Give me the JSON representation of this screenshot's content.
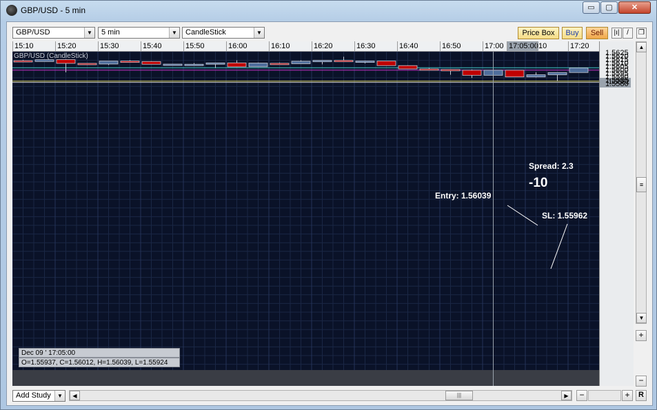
{
  "window": {
    "title": "GBP/USD - 5 min",
    "minimize_glyph": "▭",
    "maximize_glyph": "▢",
    "close_glyph": "✕"
  },
  "toolbar": {
    "symbol": "GBP/USD",
    "interval": "5 min",
    "chart_type": "CandleStick",
    "price_box": "Price Box",
    "buy": "Buy",
    "sell": "Sell"
  },
  "chart": {
    "label": "GBP/USD (CandleStick)",
    "time_ticks": [
      "15:10",
      "15:20",
      "15:30",
      "15:40",
      "15:50",
      "16:00",
      "16:10",
      "16:20",
      "16:30",
      "16:40",
      "16:50",
      "17:00",
      "17:05:00",
      "10",
      "17:20"
    ],
    "price_ticks": [
      "1.5625",
      "1.5620",
      "1.5615",
      "1.5610",
      "1.5605",
      "1.5600",
      "1.5595",
      "1.5590",
      "1.5585",
      "1.5580"
    ],
    "current_price_label": "1.5582",
    "crosshair_time": "17:05:00",
    "info_date": "Dec 09 ' 17:05:00",
    "info_ohlc": "O=1.55937, C=1.56012, H=1.56039, L=1.55924",
    "annotations": {
      "entry": "Entry: 1.56039",
      "sl": "SL: 1.55962",
      "spread": "Spread: 2.3",
      "pips": "-10"
    },
    "horizontal_lines": {
      "cyan": 1.56049,
      "magenta": 1.56012,
      "yellow": 1.55851,
      "white": 1.55832
    },
    "colors": {
      "up": "#4f6e9c",
      "down": "#c00000",
      "background": "#0a1228"
    }
  },
  "chart_data": {
    "type": "candlestick",
    "ylim": [
      1.55775,
      1.56285
    ],
    "candles": [
      {
        "o": 1.56153,
        "h": 1.56163,
        "l": 1.56143,
        "c": 1.5614
      },
      {
        "o": 1.5614,
        "h": 1.56168,
        "l": 1.5614,
        "c": 1.56167
      },
      {
        "o": 1.56168,
        "h": 1.56175,
        "l": 1.5598,
        "c": 1.56113
      },
      {
        "o": 1.56113,
        "h": 1.56118,
        "l": 1.5609,
        "c": 1.56103
      },
      {
        "o": 1.56103,
        "h": 1.56147,
        "l": 1.56088,
        "c": 1.56146
      },
      {
        "o": 1.56147,
        "h": 1.5616,
        "l": 1.5614,
        "c": 1.5614
      },
      {
        "o": 1.5614,
        "h": 1.56146,
        "l": 1.56098,
        "c": 1.561
      },
      {
        "o": 1.561,
        "h": 1.56104,
        "l": 1.56097,
        "c": 1.56102
      },
      {
        "o": 1.561,
        "h": 1.56116,
        "l": 1.56082,
        "c": 1.561
      },
      {
        "o": 1.56101,
        "h": 1.56116,
        "l": 1.56045,
        "c": 1.5612
      },
      {
        "o": 1.5612,
        "h": 1.56158,
        "l": 1.5606,
        "c": 1.56062
      },
      {
        "o": 1.56063,
        "h": 1.56124,
        "l": 1.56063,
        "c": 1.56117
      },
      {
        "o": 1.56114,
        "h": 1.56124,
        "l": 1.56097,
        "c": 1.56106
      },
      {
        "o": 1.56108,
        "h": 1.56158,
        "l": 1.56108,
        "c": 1.56144
      },
      {
        "o": 1.56144,
        "h": 1.56158,
        "l": 1.56098,
        "c": 1.56157
      },
      {
        "o": 1.56157,
        "h": 1.5621,
        "l": 1.56145,
        "c": 1.56147
      },
      {
        "o": 1.56147,
        "h": 1.56153,
        "l": 1.56112,
        "c": 1.56147
      },
      {
        "o": 1.56147,
        "h": 1.56147,
        "l": 1.56079,
        "c": 1.5608
      },
      {
        "o": 1.5608,
        "h": 1.56085,
        "l": 1.5603,
        "c": 1.56031
      },
      {
        "o": 1.56031,
        "h": 1.56043,
        "l": 1.56019,
        "c": 1.56023
      },
      {
        "o": 1.56023,
        "h": 1.56027,
        "l": 1.55945,
        "c": 1.56014
      },
      {
        "o": 1.56012,
        "h": 1.56022,
        "l": 1.55899,
        "c": 1.55937
      },
      {
        "o": 1.55937,
        "h": 1.56039,
        "l": 1.55924,
        "c": 1.56012
      },
      {
        "o": 1.56012,
        "h": 1.56012,
        "l": 1.55913,
        "c": 1.55913
      },
      {
        "o": 1.55913,
        "h": 1.5598,
        "l": 1.55906,
        "c": 1.55945
      },
      {
        "o": 1.55945,
        "h": 1.55978,
        "l": 1.55853,
        "c": 1.55978
      },
      {
        "o": 1.55978,
        "h": 1.56048,
        "l": 1.55978,
        "c": 1.56046
      }
    ]
  },
  "bottom": {
    "add_study": "Add Study",
    "r_button": "R",
    "minus": "−",
    "plus": "+"
  }
}
